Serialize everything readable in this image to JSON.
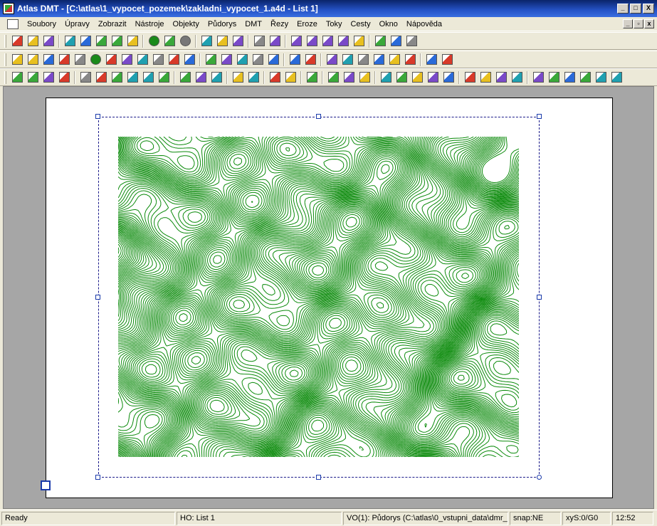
{
  "window": {
    "title": "Atlas DMT - [C:\\atlas\\1_vypocet_pozemek\\zakladni_vypocet_1.a4d - List 1]",
    "minimize": "_",
    "maximize": "□",
    "close": "X"
  },
  "menu": {
    "items": [
      "Soubory",
      "Úpravy",
      "Zobrazit",
      "Nástroje",
      "Objekty",
      "Půdorys",
      "DMT",
      "Řezy",
      "Eroze",
      "Toky",
      "Cesty",
      "Okno",
      "Nápověda"
    ]
  },
  "toolbars": {
    "row1": [
      "new-icon",
      "open-icon",
      "save-icon",
      "sep",
      "cut-icon",
      "copy-icon",
      "paste-icon",
      "undo-icon",
      "redo-icon",
      "sep",
      "green-circle-icon",
      "green-p-icon",
      "gray-circle-icon",
      "sep",
      "pointer-icon",
      "hand-icon",
      "zoom-window-icon",
      "sep",
      "zoom-icon",
      "zoom-out-icon",
      "sep",
      "layers-icon",
      "table-icon",
      "text-icon",
      "properties-icon",
      "settings-icon",
      "sep",
      "graph-icon",
      "checklist-icon",
      "close-x-icon"
    ],
    "row2": [
      "point-icon",
      "line-icon",
      "polygon-icon",
      "segment-icon",
      "rect-icon",
      "circle-icon",
      "node-icon",
      "text-a-icon",
      "symbol-icon",
      "rotate-icon",
      "measure-icon",
      "frame-icon",
      "sep",
      "group-icon",
      "group2-icon",
      "group3-icon",
      "group4-icon",
      "group5-icon",
      "sep",
      "open-folder-icon",
      "grid-icon",
      "sep",
      "color-layers-icon",
      "grid2-icon",
      "grid3-icon",
      "label-icon",
      "palette-icon",
      "color-wheel-icon",
      "sep",
      "select-x-icon",
      "select-y-icon"
    ],
    "row3": [
      "pudo-icon",
      "dmt-icon",
      "data-icon",
      "edi-dmt-icon",
      "sep",
      "tin-icon",
      "tin2-icon",
      "tin3-icon",
      "contour-color-icon",
      "slope-icon",
      "triangle-icon",
      "sep",
      "cross-section-icon",
      "profile-icon",
      "terrain-icon",
      "sep",
      "red-points-icon",
      "red-points2-icon",
      "sep",
      "hatch-icon",
      "hatch2-icon",
      "sep",
      "dmt-export-icon",
      "sep",
      "arrow-up-icon",
      "arrow-up2-icon",
      "arrow-x-icon",
      "sep",
      "point-j-icon",
      "point-plus-icon",
      "point-move-icon",
      "point-down-icon",
      "point-updown-icon",
      "sep",
      "flow-icon",
      "flow2-icon",
      "flow3-icon",
      "flow4-icon",
      "sep",
      "ok-icon",
      "bucket-icon",
      "dxf-icon",
      "dxf2-icon",
      "export-icon",
      "final-icon"
    ]
  },
  "status": {
    "ready": "Ready",
    "ho": "HO: List 1",
    "vo": "VO(1): Půdorys (C:\\atlas\\0_vstupni_data\\dmr_",
    "snap": "snap:NE",
    "xys": "xyS:0/G0",
    "time": "12:52"
  },
  "colors": {
    "contour": "#0A8A0A",
    "titlebar": "#0A246A",
    "frame": "#1a3aaa"
  }
}
